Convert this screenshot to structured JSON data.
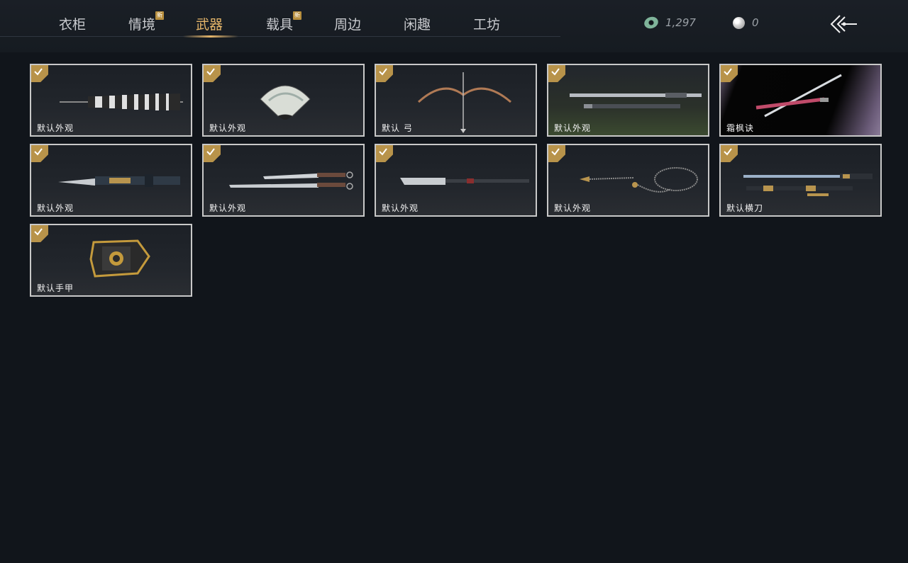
{
  "tabs": [
    {
      "label": "衣柜",
      "new": false,
      "active": false
    },
    {
      "label": "情境",
      "new": true,
      "active": false
    },
    {
      "label": "武器",
      "new": false,
      "active": true
    },
    {
      "label": "载具",
      "new": true,
      "active": false
    },
    {
      "label": "周边",
      "new": false,
      "active": false
    },
    {
      "label": "闲趣",
      "new": false,
      "active": false
    },
    {
      "label": "工坊",
      "new": false,
      "active": false
    }
  ],
  "new_badge": "新",
  "currency": {
    "jade_amount": "1,297",
    "pearl_amount": "0"
  },
  "colors": {
    "accent": "#e6b66a",
    "check_badge": "#b8934a",
    "background": "#11151b"
  },
  "items": [
    {
      "label": "默认外观",
      "weapon": "umbrella-icon",
      "equipped": true
    },
    {
      "label": "默认外观",
      "weapon": "fan-icon",
      "equipped": true
    },
    {
      "label": "默认 弓",
      "weapon": "bow-icon",
      "equipped": true
    },
    {
      "label": "默认外观",
      "weapon": "staff-icon",
      "equipped": true
    },
    {
      "label": "霜枫诀",
      "weapon": "sword-icon",
      "equipped": true
    },
    {
      "label": "默认外观",
      "weapon": "double-blade-icon",
      "equipped": true
    },
    {
      "label": "默认外观",
      "weapon": "twin-sabres-icon",
      "equipped": true
    },
    {
      "label": "默认外观",
      "weapon": "glaive-icon",
      "equipped": true
    },
    {
      "label": "默认外观",
      "weapon": "rope-dart-icon",
      "equipped": true
    },
    {
      "label": "默认横刀",
      "weapon": "hengdao-icon",
      "equipped": true
    },
    {
      "label": "默认手甲",
      "weapon": "gauntlet-icon",
      "equipped": true
    }
  ]
}
